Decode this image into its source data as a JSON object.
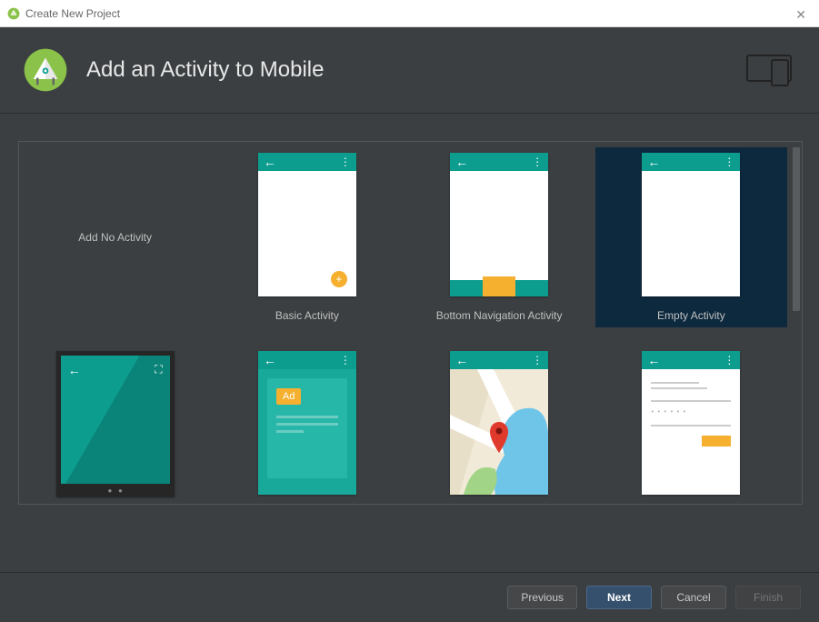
{
  "window": {
    "title": "Create New Project"
  },
  "header": {
    "title": "Add an Activity to Mobile"
  },
  "templates": {
    "no_activity": "Add No Activity",
    "basic": "Basic Activity",
    "bottom_nav": "Bottom Navigation Activity",
    "empty": "Empty Activity",
    "ad_label": "Ad"
  },
  "selected_template": "empty",
  "footer": {
    "previous": "Previous",
    "next": "Next",
    "cancel": "Cancel",
    "finish": "Finish"
  }
}
